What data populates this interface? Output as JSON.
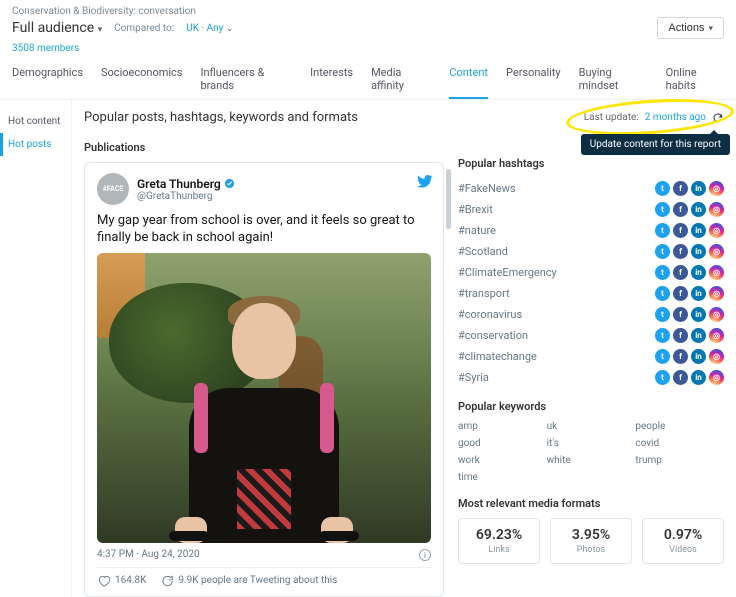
{
  "header": {
    "breadcrumb": "Conservation & Biodiversity: conversation",
    "audience": "Full audience",
    "compared_label": "Compared to:",
    "compared_value": "UK · Any",
    "members": "3508 members",
    "actions_label": "Actions"
  },
  "tabs": [
    "Demographics",
    "Socioeconomics",
    "Influencers & brands",
    "Interests",
    "Media affinity",
    "Content",
    "Personality",
    "Buying mindset",
    "Online habits"
  ],
  "active_tab": 5,
  "sidebar": {
    "items": [
      "Hot content",
      "Hot posts"
    ],
    "active": 1
  },
  "page_title": "Popular posts, hashtags, keywords and formats",
  "last_update_label": "Last update:",
  "last_update_value": "2 months ago",
  "tooltip_text": "Update content for this report",
  "publications_title": "Publications",
  "tweet": {
    "user": "Greta Thunberg",
    "handle": "@GretaThunberg",
    "avatar_text": "#FACE",
    "body": "My gap year from school is over, and it feels so great to finally be back in school again!",
    "time": "4:37 PM · Aug 24, 2020",
    "likes": "164.8K",
    "talking": "9.9K people are Tweeting about this"
  },
  "hashtags_title": "Popular hashtags",
  "hashtags": [
    "#FakeNews",
    "#Brexit",
    "#nature",
    "#Scotland",
    "#ClimateEmergency",
    "#transport",
    "#coronavirus",
    "#conservation",
    "#climatechange",
    "#Syria"
  ],
  "keywords_title": "Popular keywords",
  "keywords": [
    "amp",
    "uk",
    "people",
    "good",
    "it's",
    "covid",
    "work",
    "white",
    "trump",
    "time"
  ],
  "media_title": "Most relevant media formats",
  "media": [
    {
      "pct": "69.23%",
      "label": "Links"
    },
    {
      "pct": "3.95%",
      "label": "Photos"
    },
    {
      "pct": "0.97%",
      "label": "Videos"
    }
  ]
}
